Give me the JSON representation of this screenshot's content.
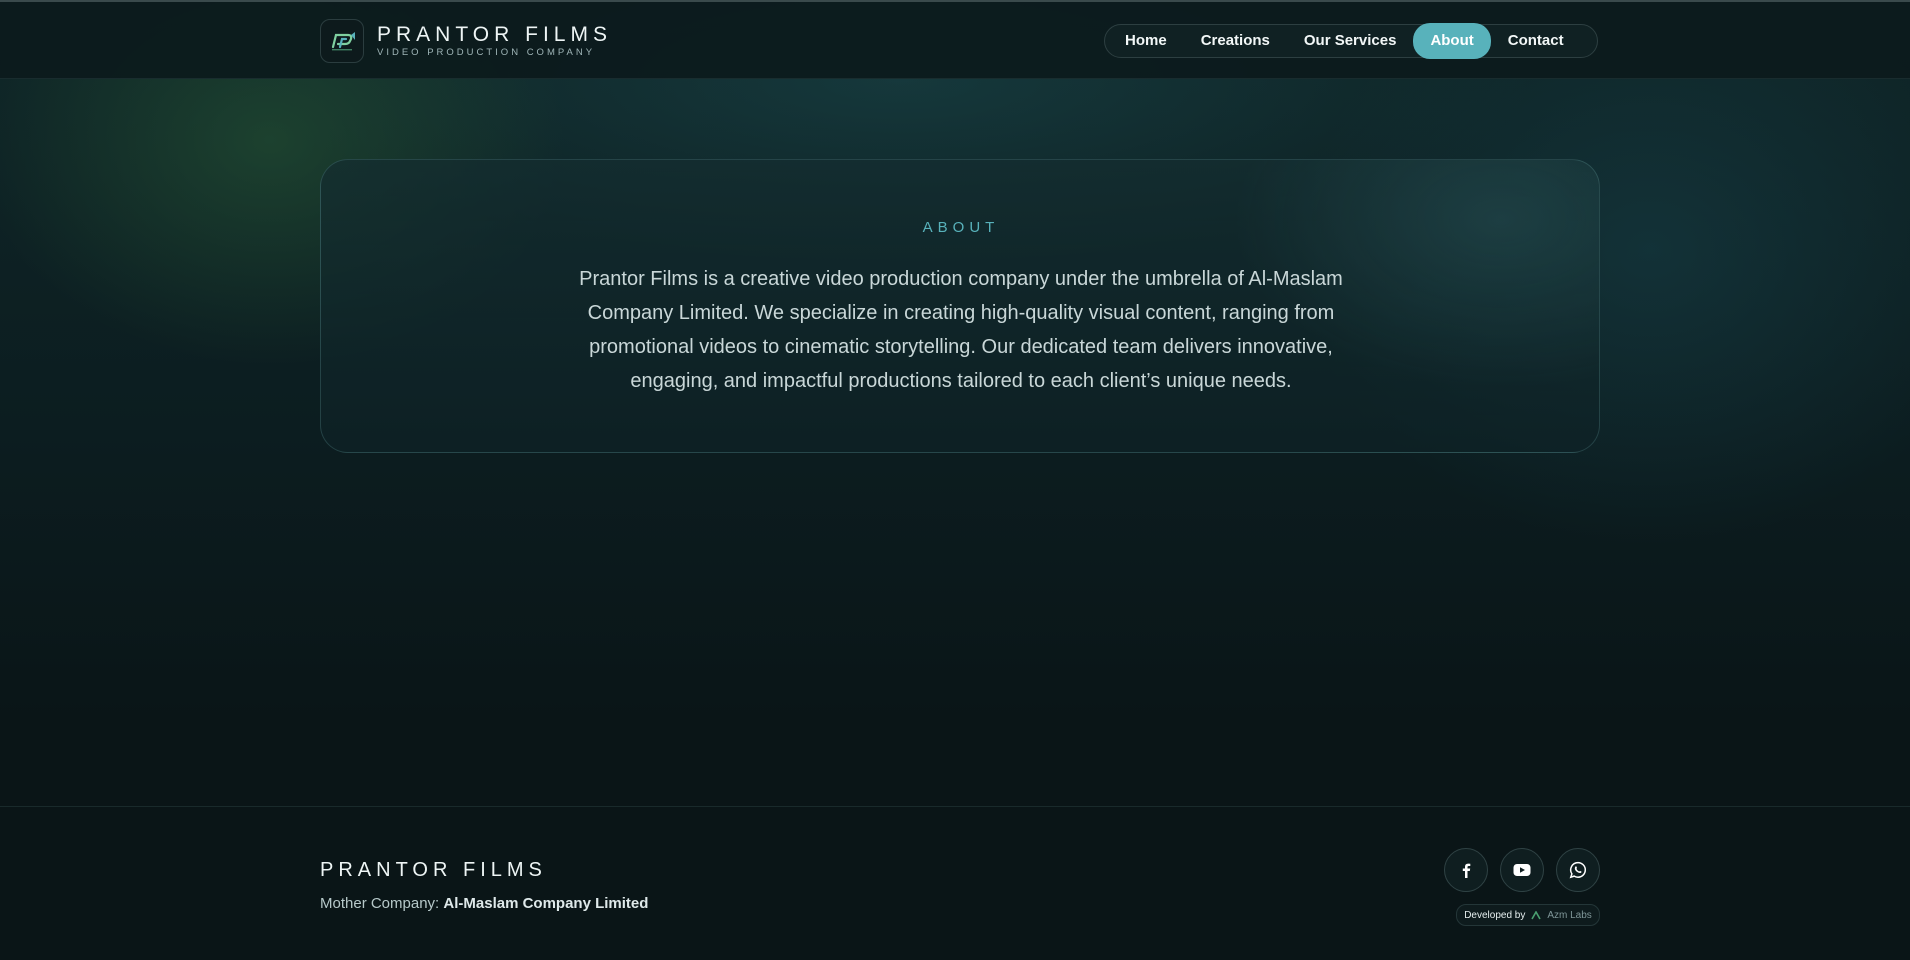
{
  "header": {
    "brand_name": "PRANTOR FILMS",
    "brand_sub": "VIDEO PRODUCTION COMPANY",
    "nav": [
      {
        "label": "Home",
        "active": false
      },
      {
        "label": "Creations",
        "active": false
      },
      {
        "label": "Our Services",
        "active": false
      },
      {
        "label": "About",
        "active": true
      },
      {
        "label": "Contact",
        "active": false
      }
    ]
  },
  "about": {
    "label": "ABOUT",
    "text": "Prantor Films is a creative video production company under the umbrella of Al-Maslam Company Limited. We specialize in creating high-quality visual content, ranging from promotional videos to cinematic storytelling. Our dedicated team delivers innovative, engaging, and impactful productions tailored to each client’s unique needs."
  },
  "footer": {
    "brand_name": "PRANTOR FILMS",
    "mother_label": "Mother Company:",
    "mother_company": "Al-Maslam Company Limited",
    "socials": [
      "facebook-icon",
      "youtube-icon",
      "whatsapp-icon"
    ],
    "developed_by": "Developed by",
    "developer": "Azm Labs"
  },
  "colors": {
    "accent": "#58b2bb",
    "background": "#0a1517"
  }
}
